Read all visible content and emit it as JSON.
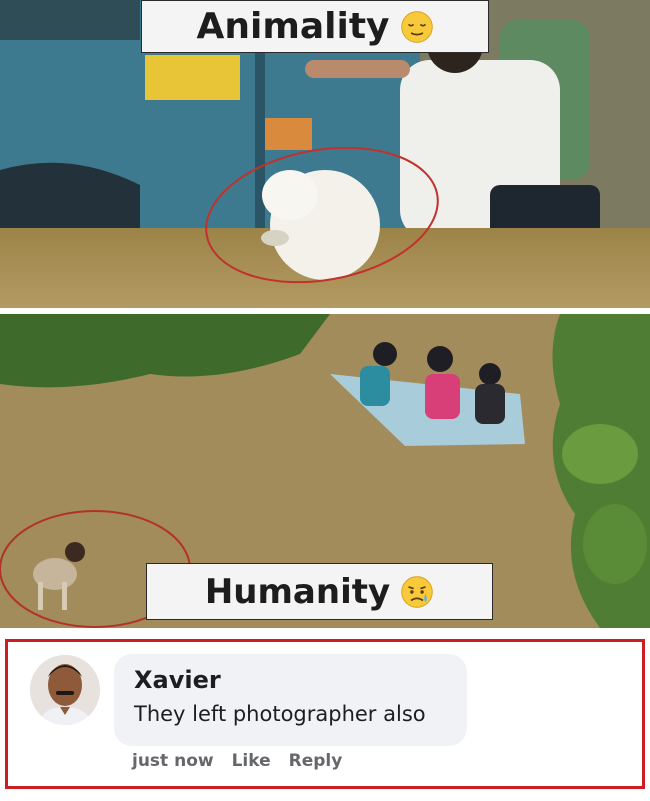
{
  "meme": {
    "top_caption": "Animality",
    "top_emoji": "relieved-face-icon",
    "bottom_caption": "Humanity",
    "bottom_emoji": "sad-relieved-face-icon"
  },
  "comment": {
    "author": "Xavier",
    "text": "They left photographer also",
    "timestamp": "just now",
    "like_label": "Like",
    "reply_label": "Reply",
    "highlight_color": "#cc1d22"
  },
  "colors": {
    "flood_water": "#a3894f",
    "truck_blue": "#3f7d93",
    "bubble_bg": "#f0f2f5"
  }
}
